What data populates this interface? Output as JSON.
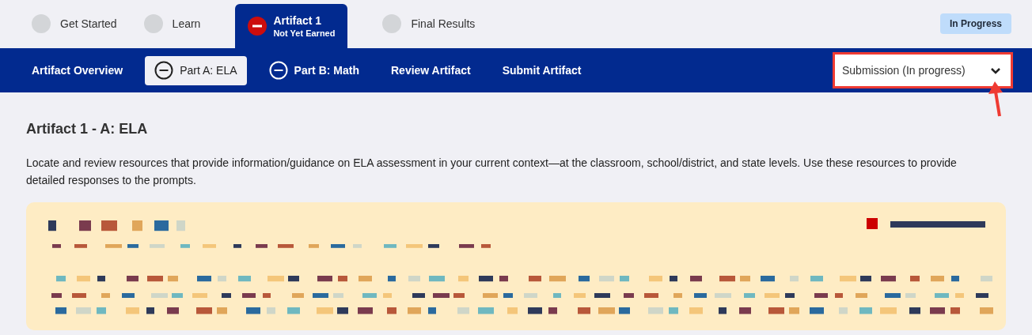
{
  "steps": [
    {
      "label": "Get Started",
      "kind": "grey_dot",
      "selected": false
    },
    {
      "label": "Learn",
      "kind": "grey_dot",
      "selected": false
    },
    {
      "label": "Artifact 1",
      "sublabel": "Not Yet Earned",
      "kind": "red_minus",
      "selected": true
    },
    {
      "label": "Final Results",
      "kind": "grey_dot",
      "selected": false
    }
  ],
  "status_badge": "In Progress",
  "nav": [
    {
      "label": "Artifact Overview",
      "kind": "plain",
      "selected": false
    },
    {
      "label": "Part A: ELA",
      "kind": "icon",
      "selected": true
    },
    {
      "label": "Part B: Math",
      "kind": "icon",
      "selected": false
    },
    {
      "label": "Review Artifact",
      "kind": "plain",
      "selected": false
    },
    {
      "label": "Submit Artifact",
      "kind": "plain",
      "selected": false
    }
  ],
  "submission_select": {
    "value": "Submission (In progress)",
    "highlighted": true
  },
  "heading": "Artifact 1 - A: ELA",
  "description": "Locate and review resources that provide information/guidance on ELA assessment in your current context—at the classroom, school/district, and state levels. Use these resources to provide detailed responses to the prompts."
}
